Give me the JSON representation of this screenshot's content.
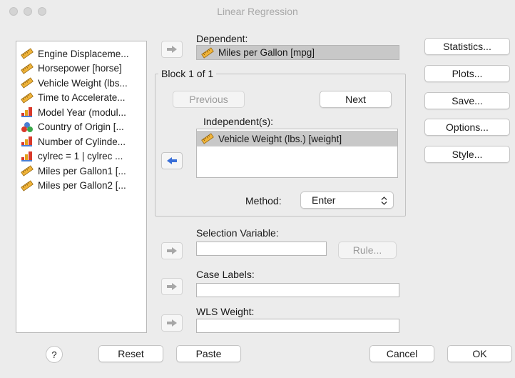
{
  "window": {
    "title": "Linear Regression"
  },
  "variables": [
    {
      "label": "Engine Displaceme...",
      "icon": "scale-ruler-icon"
    },
    {
      "label": "Horsepower [horse]",
      "icon": "scale-ruler-icon"
    },
    {
      "label": "Vehicle Weight (lbs...",
      "icon": "scale-ruler-icon"
    },
    {
      "label": "Time to Accelerate...",
      "icon": "scale-ruler-icon"
    },
    {
      "label": "Model Year (modul...",
      "icon": "ordinal-bars-icon"
    },
    {
      "label": "Country of Origin [...",
      "icon": "nominal-circles-icon"
    },
    {
      "label": "Number of Cylinde...",
      "icon": "ordinal-bars-icon"
    },
    {
      "label": "cylrec = 1 | cylrec ...",
      "icon": "ordinal-bars-icon"
    },
    {
      "label": "Miles per Gallon1 [...",
      "icon": "scale-ruler-icon"
    },
    {
      "label": "Miles per Gallon2 [...",
      "icon": "scale-ruler-icon"
    }
  ],
  "dependent": {
    "label": "Dependent:",
    "value": "Miles per Gallon [mpg]"
  },
  "block": {
    "title": "Block 1 of 1",
    "previous": "Previous",
    "next": "Next",
    "independent_label": "Independent(s):",
    "independents": [
      "Vehicle Weight (lbs.) [weight]"
    ],
    "method_label": "Method:",
    "method_value": "Enter"
  },
  "selection_variable": {
    "label": "Selection Variable:",
    "value": "",
    "rule_button": "Rule..."
  },
  "case_labels": {
    "label": "Case Labels:",
    "value": ""
  },
  "wls_weight": {
    "label": "WLS Weight:",
    "value": ""
  },
  "side_buttons": {
    "statistics": "Statistics...",
    "plots": "Plots...",
    "save": "Save...",
    "options": "Options...",
    "style": "Style..."
  },
  "footer": {
    "help": "?",
    "reset": "Reset",
    "paste": "Paste",
    "cancel": "Cancel",
    "ok": "OK"
  },
  "colors": {
    "background": "#ececec",
    "selected_fill": "#c8c8c8",
    "arrow_active": "#3a6fd8",
    "arrow_inactive": "#a7a7a7",
    "ruler": "#e3a21a"
  }
}
